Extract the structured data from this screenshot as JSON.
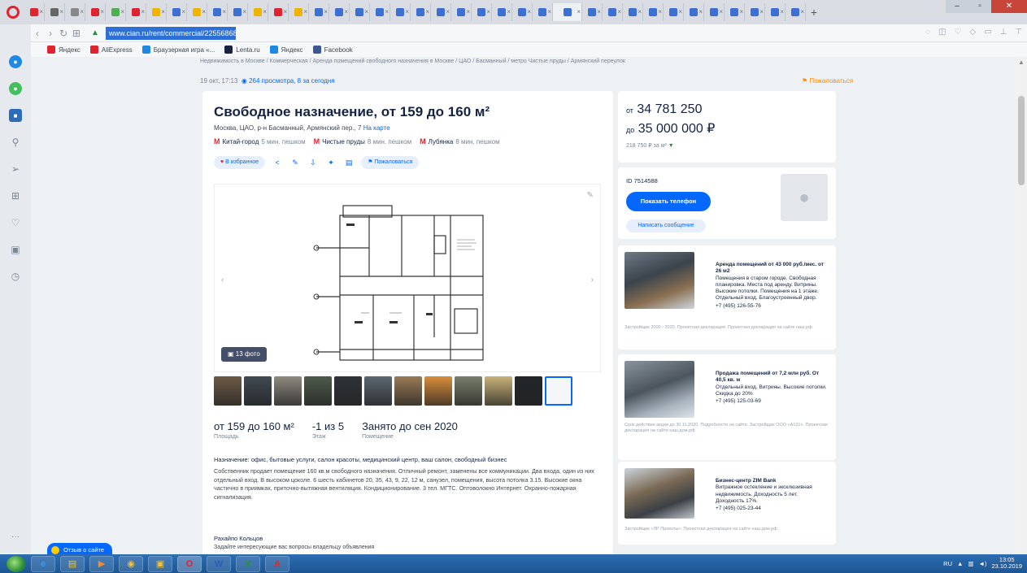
{
  "browser": {
    "tab_count": 38,
    "tab_favicons": [
      "#e0242f",
      "#666666",
      "#888888",
      "#e0242f",
      "#4caf50",
      "#e0242f",
      "#f0b400",
      "#3b6fd4",
      "#f0b400",
      "#3b6fd4",
      "#3b6fd4",
      "#f0b400",
      "#e0242f",
      "#f0b400",
      "#3b6fd4",
      "#3b6fd4",
      "#3b6fd4",
      "#3b6fd4",
      "#3b6fd4",
      "#3b6fd4",
      "#3b6fd4",
      "#3b6fd4",
      "#3b6fd4",
      "#3b6fd4",
      "#3b6fd4",
      "#3b6fd4",
      "#3b6fd4",
      "#3b6fd4",
      "#3b6fd4",
      "#3b6fd4",
      "#3b6fd4",
      "#3b6fd4",
      "#3b6fd4",
      "#3b6fd4",
      "#3b6fd4",
      "#3b6fd4",
      "#3b6fd4",
      "#3b6fd4"
    ],
    "active_tab_index": 26,
    "new_tab_label": "+",
    "url": "www.cian.ru/rent/commercial/225568688/",
    "bookmarks": [
      {
        "label": "Яндекс",
        "color": "#e0242f"
      },
      {
        "label": "AliExpress",
        "color": "#e0242f"
      },
      {
        "label": "Браузерная игра «...",
        "color": "#1e88e5"
      },
      {
        "label": "Lenta.ru",
        "color": "#152242"
      },
      {
        "label": "Яндекс",
        "color": "#1e88e5"
      },
      {
        "label": "Facebook",
        "color": "#3b5998"
      }
    ]
  },
  "page": {
    "breadcrumbs": "Недвижимость в Москве  /  Коммерческая  /  Аренда помещений свободного назначения в Москве  /  ЦАО  /  Басманный  /  метро Чистые пруды  /  Армянский переулок",
    "meta_date": "19 окт, 17:13",
    "meta_views": "264 просмотра, 8 за сегодня",
    "report_link": "Пожаловаться",
    "title": "Свободное назначение, от 159 до 160 м²",
    "address": "Москва, ЦАО, р-н Басманный, Армянский пер., 7",
    "map_link": "На карте",
    "metro": [
      {
        "name": "Китай-город",
        "walk": "5 мин. пешком"
      },
      {
        "name": "Чистые пруды",
        "walk": "8 мин. пешком"
      },
      {
        "name": "Лубянка",
        "walk": "8 мин. пешком"
      }
    ],
    "favorite_label": "В избранное",
    "complain_label": "Пожаловаться",
    "photo_count": "13 фото",
    "summary": [
      {
        "value": "от 159 до 160 м²",
        "label": "Площадь"
      },
      {
        "value": "-1 из 5",
        "label": "Этаж"
      },
      {
        "value": "Занято до сен 2020",
        "label": "Помещение"
      }
    ],
    "purpose": "Назначение: офис, бытовые услуги, салон красоты, медицинский центр, ваш салон, свободный бизнес",
    "description": "Собственник продает помещение 160 кв.м свободного назначения. Отличный ремонт, заменены все коммуникации. Два входа, один из них отдельный вход. В высоком цоколе. 6 шесть кабинетов 20, 35, 43, 9, 22, 12 м, санузел, помещения, высота потолка 3.15. Высокие окна частично в приямках, приточно-вытяжная вентиляция. Кондиционирование. 3 тел. МГТС. Оптоволокно Интернет. Охранно-пожарная сигнализация.",
    "seller_name": "Рахайпо Кольцов",
    "seller_hint": "Задайте интересующие вас вопросы владельцу объявления"
  },
  "price": {
    "from_prefix": "от",
    "from_value": "34 781 250",
    "to_prefix": "до",
    "to_value": "35 000 000 ₽",
    "per_meter": "218 750 ₽ за м²"
  },
  "contact": {
    "listing_id": "ID 7514588",
    "show_phone": "Показать телефон",
    "write_message": "Написать сообщение"
  },
  "ads": [
    {
      "headline": "Аренда помещений от 43 000 руб./мес. от 26 м2",
      "body": "Помещения в старом городе. Свободная планировка. Места под аренду. Витрины. Высокие потолки. Помещения на 1 этаже. Отдельный вход. Благоустроенный двор.",
      "phone": "+7 (495) 126-55-76",
      "legal": "Застройщик 2000 - 2020. Проектная декларация. Проектная декларация на сайте наш.рф"
    },
    {
      "headline": "Продажа помещений от 7,2 млн руб. От 40,5 кв. м",
      "body": "Отдельный вход. Витрины. Высокие потолки. Скидка до 20%",
      "phone": "+7 (495) 125-03-69",
      "legal": "Срок действия акции до 30.11.2020. Подробности на сайте. Застройщик ООО «А101». Проектная декларация на сайте наш.дом.рф"
    },
    {
      "headline": "Бизнес-центр ZIM Bank",
      "body": "Витражное остекление и эксклюзивная недвижимость. Доходность 5 лет. Доходность 17%.",
      "phone": "+7 (495) 025-23-44",
      "legal": "Застройщик «ЛР Проекты». Проектная декларация на сайте наш.дом.рф"
    }
  ],
  "chat": {
    "label": "Отзыв о сайте"
  },
  "taskbar": {
    "apps": [
      {
        "glyph": "e",
        "color": "#3a9bf0"
      },
      {
        "glyph": "▤",
        "color": "#f0c040"
      },
      {
        "glyph": "▶",
        "color": "#f08a30"
      },
      {
        "glyph": "◉",
        "color": "#f0c040"
      },
      {
        "glyph": "▣",
        "color": "#f0c040"
      },
      {
        "glyph": "O",
        "color": "#e0242f"
      },
      {
        "glyph": "W",
        "color": "#2b5cb8"
      },
      {
        "glyph": "X",
        "color": "#2f8f3a"
      },
      {
        "glyph": "A",
        "color": "#d32f2f"
      }
    ],
    "time": "13:05",
    "date": "23.10.2019",
    "lang": "RU"
  }
}
